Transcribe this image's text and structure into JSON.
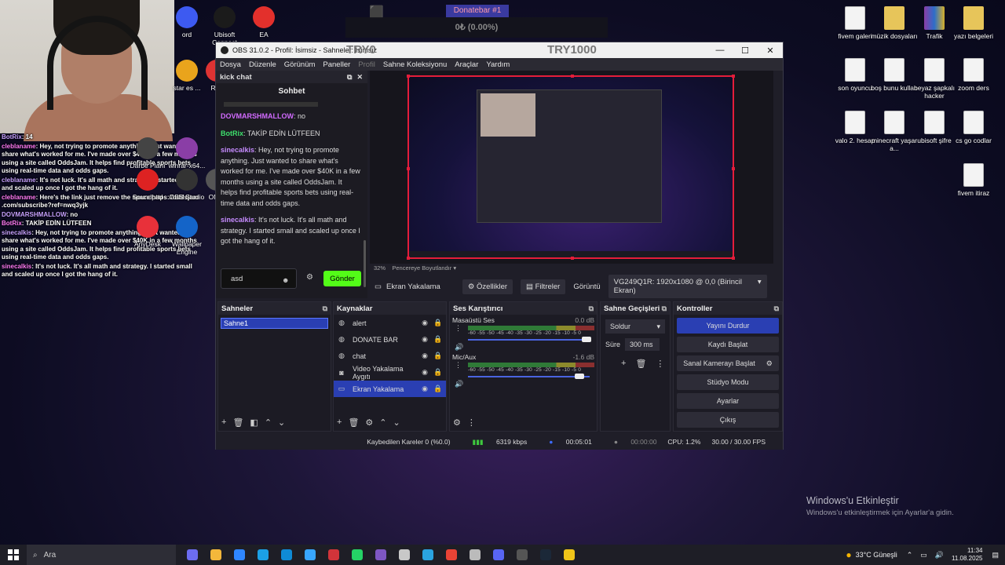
{
  "overlay": {
    "donation_label": "Donatebar #1",
    "donation_amount": "0₺ (0.00%)",
    "brand_left": "TRY0",
    "brand_right": "TRY1000",
    "stream_chat": [
      {
        "user": "BotRix",
        "text": ": 14"
      },
      {
        "user": "cleblaname",
        "text": ": Hey, not trying to promote anything. Just wanted to share what's worked for me. I've made over $40K in a few months using a site called OddsJam. It helps find profitable sports bets using real-time data and odds gaps."
      },
      {
        "user": "cleblaname",
        "text": ": It's not luck. It's all math and strategy. I started small and scaled up once I got the hang of it."
      },
      {
        "user": "cleblaname",
        "text": ": Here's the link just remove the space https://oddsjam .com/subscribe?ref=nwq3yjk"
      },
      {
        "user": "DOVMARSHMALLOW",
        "text": ": no"
      },
      {
        "user": "BotRix",
        "text": ": TAKİP EDİN LÜTFEEN"
      },
      {
        "user": "sinecalkis",
        "text": ": Hey, not trying to promote anything. Just wanted to share what's worked for me. I've made over $40K in a few months using a site called OddsJam. It helps find profitable sports bets using real-time data and odds gaps."
      },
      {
        "user": "sinecalkis",
        "text": ": It's not luck. It's all math and strategy. I started small and scaled up once I got the hang of it."
      }
    ]
  },
  "desktop_left_icons": [
    {
      "label": "ord",
      "icon": "app-icon",
      "color": "#3d5af1"
    },
    {
      "label": "Ubisoft Connect",
      "icon": "ubisoft-icon",
      "color": "#1b1b1b"
    },
    {
      "label": "EA",
      "icon": "ea-icon",
      "color": "#e3302c"
    },
    {
      "label": "star es ...",
      "icon": "app-icon",
      "color": "#e9a41c"
    },
    {
      "label": "Riot",
      "icon": "riot-icon",
      "color": "#d33"
    },
    {
      "label": "Darbe Planı",
      "icon": "app-icon",
      "color": "#444"
    },
    {
      "label": "winrar-x64...",
      "icon": "winrar-icon",
      "color": "#8a3ea6"
    },
    {
      "label": "Soundpad",
      "icon": "soundpad-icon",
      "color": "#d22"
    },
    {
      "label": "OBS Studio",
      "icon": "obs-icon",
      "color": "#333"
    },
    {
      "label": "ONIK",
      "icon": "app-icon",
      "color": "#555"
    },
    {
      "label": "AnyDesk",
      "icon": "anydesk-icon",
      "color": "#e8313a"
    },
    {
      "label": "Wallpaper Engine",
      "icon": "wallpaper-icon",
      "color": "#1464c8"
    }
  ],
  "desktop_right_icons": [
    {
      "label": "fivem galeri",
      "type": "file"
    },
    {
      "label": "müzik dosyaları",
      "type": "folder"
    },
    {
      "label": "Trafik",
      "type": "rar"
    },
    {
      "label": "yazı belgeleri",
      "type": "folder"
    },
    {
      "label": "son oyuncu",
      "type": "file"
    },
    {
      "label": "boş bunu kullan",
      "type": "file"
    },
    {
      "label": "beyaz şapkalı hacker",
      "type": "file"
    },
    {
      "label": "zoom ders",
      "type": "file"
    },
    {
      "label": "valo 2. hesap",
      "type": "file"
    },
    {
      "label": "minecraft yaşar a...",
      "type": "file"
    },
    {
      "label": "ubisoft şifre",
      "type": "file"
    },
    {
      "label": "cs go codlar",
      "type": "file"
    },
    {
      "label": "fivem itiraz",
      "type": "file"
    }
  ],
  "obs": {
    "title": "OBS 31.0.2 - Profil: İsimsiz - Sahneler: İsimsiz",
    "menu": [
      "Dosya",
      "Düzenle",
      "Görünüm",
      "Paneller",
      "Profil",
      "Sahne Koleksiyonu",
      "Araçlar",
      "Yardım"
    ],
    "chat_dock": {
      "title": "kick chat",
      "tab": "Sohbet",
      "messages": [
        {
          "user": "DOVMARSHMALLOW",
          "text": ": no",
          "style": "u1"
        },
        {
          "user": "BotRix",
          "text": ": TAKİP EDİN LÜTFEEN",
          "style": "u2"
        },
        {
          "user": "sinecalkis",
          "text": ": Hey, not trying to promote anything. Just wanted to share what's worked for me. I've made over $40K in a few months using a site called OddsJam. It helps find profitable sports bets using real-time data and odds gaps.",
          "style": "u3"
        },
        {
          "user": "sinecalkis",
          "text": ": It's not luck. It's all math and strategy. I started small and scaled up once I got the hang of it.",
          "style": "u3"
        }
      ],
      "input_value": "asd",
      "send_label": "Gönder"
    },
    "zoom": "32%",
    "fit_label": "Pencereye Boyutlandır",
    "source_bar": {
      "source_name": "Ekran Yakalama",
      "properties": "Özellikler",
      "filters": "Filtreler",
      "display_label": "Görüntü",
      "display_value": "VG249Q1R: 1920x1080 @ 0,0 (Birincil Ekran)"
    },
    "scenes": {
      "title": "Sahneler",
      "items": [
        "Sahne1"
      ]
    },
    "sources": {
      "title": "Kaynaklar",
      "items": [
        {
          "name": "alert",
          "icon": "browser-icon"
        },
        {
          "name": "DONATE BAR",
          "icon": "browser-icon"
        },
        {
          "name": "chat",
          "icon": "browser-icon"
        },
        {
          "name": "Video Yakalama Aygıtı",
          "icon": "camera-icon"
        },
        {
          "name": "Ekran Yakalama",
          "icon": "monitor-icon"
        }
      ],
      "selected": 4
    },
    "mixer": {
      "title": "Ses Karıştırıcı",
      "scale": "-60 -55 -50 -45 -40 -35 -30 -25 -20 -15 -10 -5 0",
      "channels": [
        {
          "name": "Masaüstü Ses",
          "db": "0.0 dB",
          "level": 0.98
        },
        {
          "name": "Mic/Aux",
          "db": "-1.6 dB",
          "level": 0.92
        }
      ]
    },
    "transitions": {
      "title": "Sahne Geçişleri",
      "type": "Soldur",
      "duration_label": "Süre",
      "duration": "300 ms"
    },
    "controls": {
      "title": "Kontroller",
      "buttons": [
        "Yayını Durdur",
        "Kaydı Başlat",
        "Sanal Kamerayı Başlat",
        "Stüdyo Modu",
        "Ayarlar",
        "Çıkış"
      ]
    },
    "status": {
      "dropped": "Kaybedilen Kareler 0 (%0.0)",
      "bitrate": "6319 kbps",
      "stream_time": "00:05:01",
      "rec_time": "00:00:00",
      "cpu": "CPU: 1.2%",
      "fps": "30.00 / 30.00 FPS"
    }
  },
  "watermark": {
    "line1": "Windows'u Etkinleştir",
    "line2": "Windows'u etkinleştirmek için Ayarlar'a gidin."
  },
  "taskbar": {
    "search_placeholder": "Ara",
    "weather": "33°C  Güneşli",
    "time": "11:34",
    "date": "11.08.2025",
    "apps": [
      "#6c6cf0",
      "#f4b73b",
      "#2f86ff",
      "#1ba0e6",
      "#0f8bd6",
      "#38a6ff",
      "#d1343a",
      "#25d366",
      "#7e57c2",
      "#c8c8c8",
      "#2aa3e0",
      "#ea4335",
      "#bbb",
      "#5865f2",
      "#555",
      "#1b2838",
      "#f0c419"
    ]
  }
}
